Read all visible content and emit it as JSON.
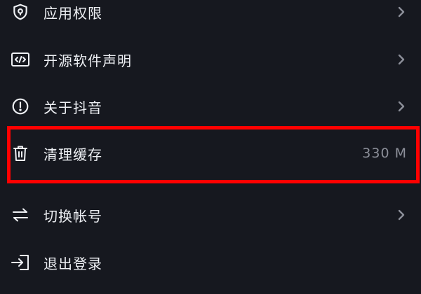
{
  "settings_list": {
    "items": [
      {
        "label": "应用权限",
        "icon": "shield-icon",
        "trailing": "chevron-right-icon"
      },
      {
        "label": "开源软件声明",
        "icon": "code-icon",
        "trailing": "chevron-right-icon"
      },
      {
        "label": "关于抖音",
        "icon": "info-icon",
        "trailing": "chevron-right-icon"
      },
      {
        "label": "清理缓存",
        "icon": "trash-icon",
        "value": "330 M"
      },
      {
        "label": "切换帐号",
        "icon": "swap-icon",
        "trailing": "chevron-right-icon"
      },
      {
        "label": "退出登录",
        "icon": "logout-icon"
      }
    ]
  },
  "colors": {
    "background": "#16181f",
    "text": "#eef0f4",
    "secondary_text": "#8c8f99",
    "highlight": "#ff0000"
  }
}
